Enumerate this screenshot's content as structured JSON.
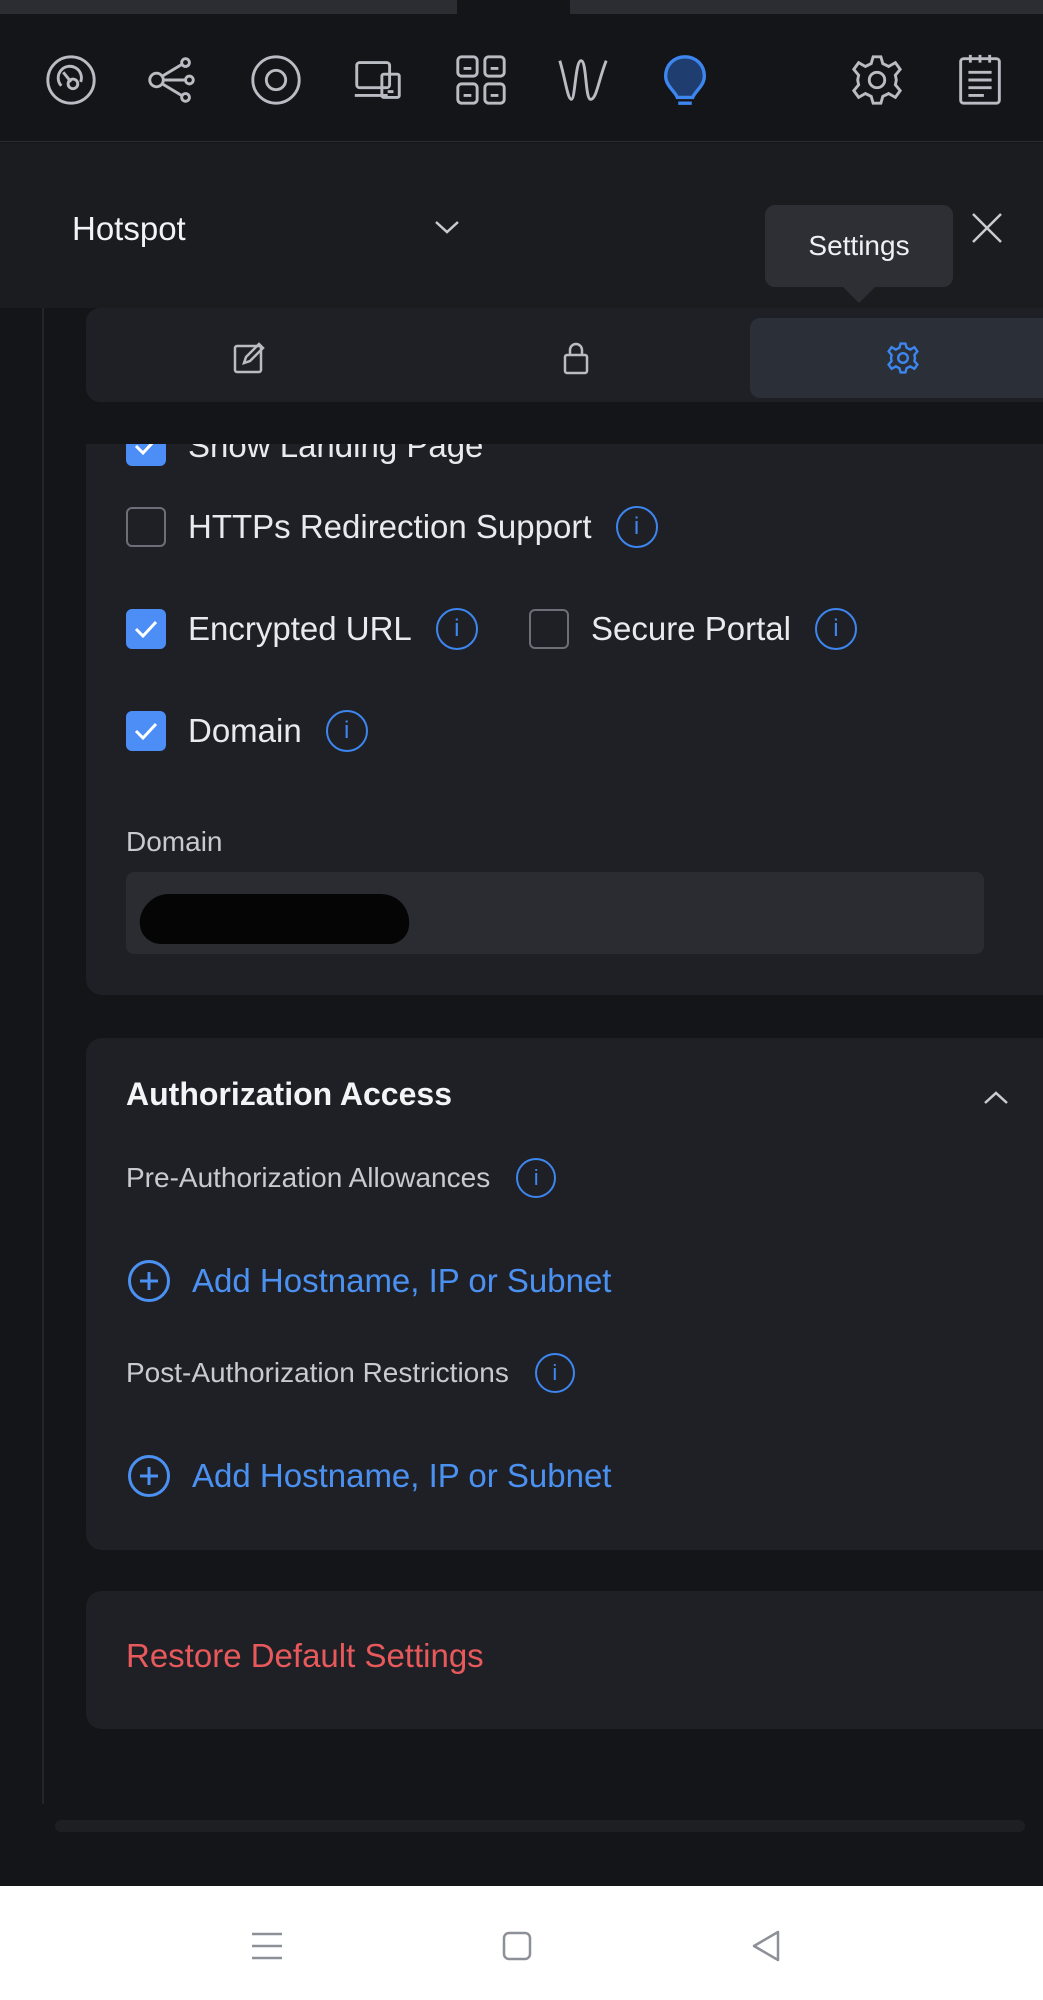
{
  "toolbar": {
    "icons": [
      {
        "name": "dashboard-icon",
        "active": false
      },
      {
        "name": "topology-icon",
        "active": false
      },
      {
        "name": "unifi-devices-icon",
        "active": false
      },
      {
        "name": "client-devices-icon",
        "active": false
      },
      {
        "name": "apps-icon",
        "active": false
      },
      {
        "name": "wifiman-icon",
        "active": false
      },
      {
        "name": "insights-icon",
        "active": true
      },
      {
        "name": "settings-icon",
        "active": false
      },
      {
        "name": "logs-icon",
        "active": false
      }
    ]
  },
  "header": {
    "network_name": "Hotspot",
    "tooltip": "Settings"
  },
  "tabs": [
    {
      "name": "edit-icon",
      "active": false
    },
    {
      "name": "lock-icon",
      "active": false
    },
    {
      "name": "gear-icon",
      "active": true
    }
  ],
  "portal_settings": {
    "partial_label": "Show Landing Page",
    "https_redirection": {
      "label": "HTTPs Redirection Support",
      "checked": false
    },
    "encrypted_url": {
      "label": "Encrypted URL",
      "checked": true
    },
    "secure_portal": {
      "label": "Secure Portal",
      "checked": false
    },
    "domain_checkbox": {
      "label": "Domain",
      "checked": true
    },
    "domain_field_label": "Domain"
  },
  "authorization": {
    "title": "Authorization Access",
    "pre_label": "Pre-Authorization Allowances",
    "pre_add": "Add Hostname, IP or Subnet",
    "post_label": "Post-Authorization Restrictions",
    "post_add": "Add Hostname, IP or Subnet"
  },
  "restore": {
    "label": "Restore Default Settings"
  },
  "info_glyph": "i",
  "colors": {
    "accent": "#4c8df6",
    "danger": "#e8595b",
    "background": "#141518",
    "card": "#1f2025"
  }
}
